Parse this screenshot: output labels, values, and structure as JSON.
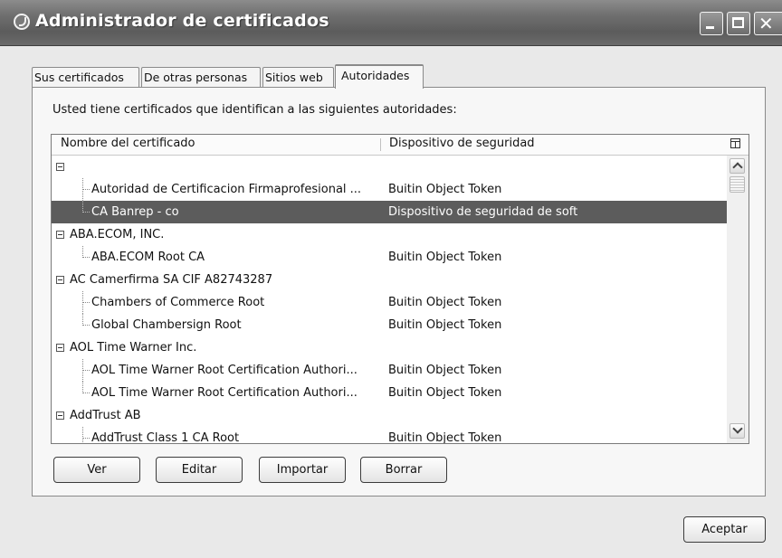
{
  "window": {
    "title": "Administrador de certificados"
  },
  "tabs": [
    {
      "label": "Sus certificados",
      "active": false
    },
    {
      "label": "De otras personas",
      "active": false
    },
    {
      "label": "Sitios web",
      "active": false
    },
    {
      "label": "Autoridades",
      "active": true
    }
  ],
  "panel": {
    "description": "Usted tiene certificados que identifican a las siguientes autoridades:",
    "columns": {
      "name": "Nombre del certificado",
      "device": "Dispositivo de seguridad"
    },
    "rows": [
      {
        "name": "",
        "device": "",
        "level": "group",
        "expanded": true
      },
      {
        "name": "Autoridad de Certificacion Firmaprofesional ...",
        "device": "Buitin Object Token",
        "level": "child"
      },
      {
        "name": "CA Banrep - co",
        "device": "Dispositivo de seguridad de soft",
        "level": "child",
        "selected": true
      },
      {
        "name": "ABA.ECOM, INC.",
        "device": "",
        "level": "group",
        "expanded": true
      },
      {
        "name": "ABA.ECOM Root CA",
        "device": "Buitin Object Token",
        "level": "child"
      },
      {
        "name": "AC Camerfirma SA CIF A82743287",
        "device": "",
        "level": "group",
        "expanded": true
      },
      {
        "name": "Chambers of Commerce Root",
        "device": "Buitin Object Token",
        "level": "child"
      },
      {
        "name": "Global Chambersign Root",
        "device": "Buitin Object Token",
        "level": "child"
      },
      {
        "name": "AOL Time Warner Inc.",
        "device": "",
        "level": "group",
        "expanded": true
      },
      {
        "name": "AOL Time Warner Root Certification Authori...",
        "device": "Buitin Object Token",
        "level": "child"
      },
      {
        "name": "AOL Time Warner Root Certification Authori...",
        "device": "Buitin Object Token",
        "level": "child"
      },
      {
        "name": "AddTrust AB",
        "device": "",
        "level": "group",
        "expanded": true
      },
      {
        "name": "AddTrust Class 1 CA Root",
        "device": "Buitin Object Token",
        "level": "child"
      }
    ]
  },
  "buttons": {
    "ver": "Ver",
    "editar": "Editar",
    "importar": "Importar",
    "borrar": "Borrar",
    "aceptar": "Aceptar"
  }
}
